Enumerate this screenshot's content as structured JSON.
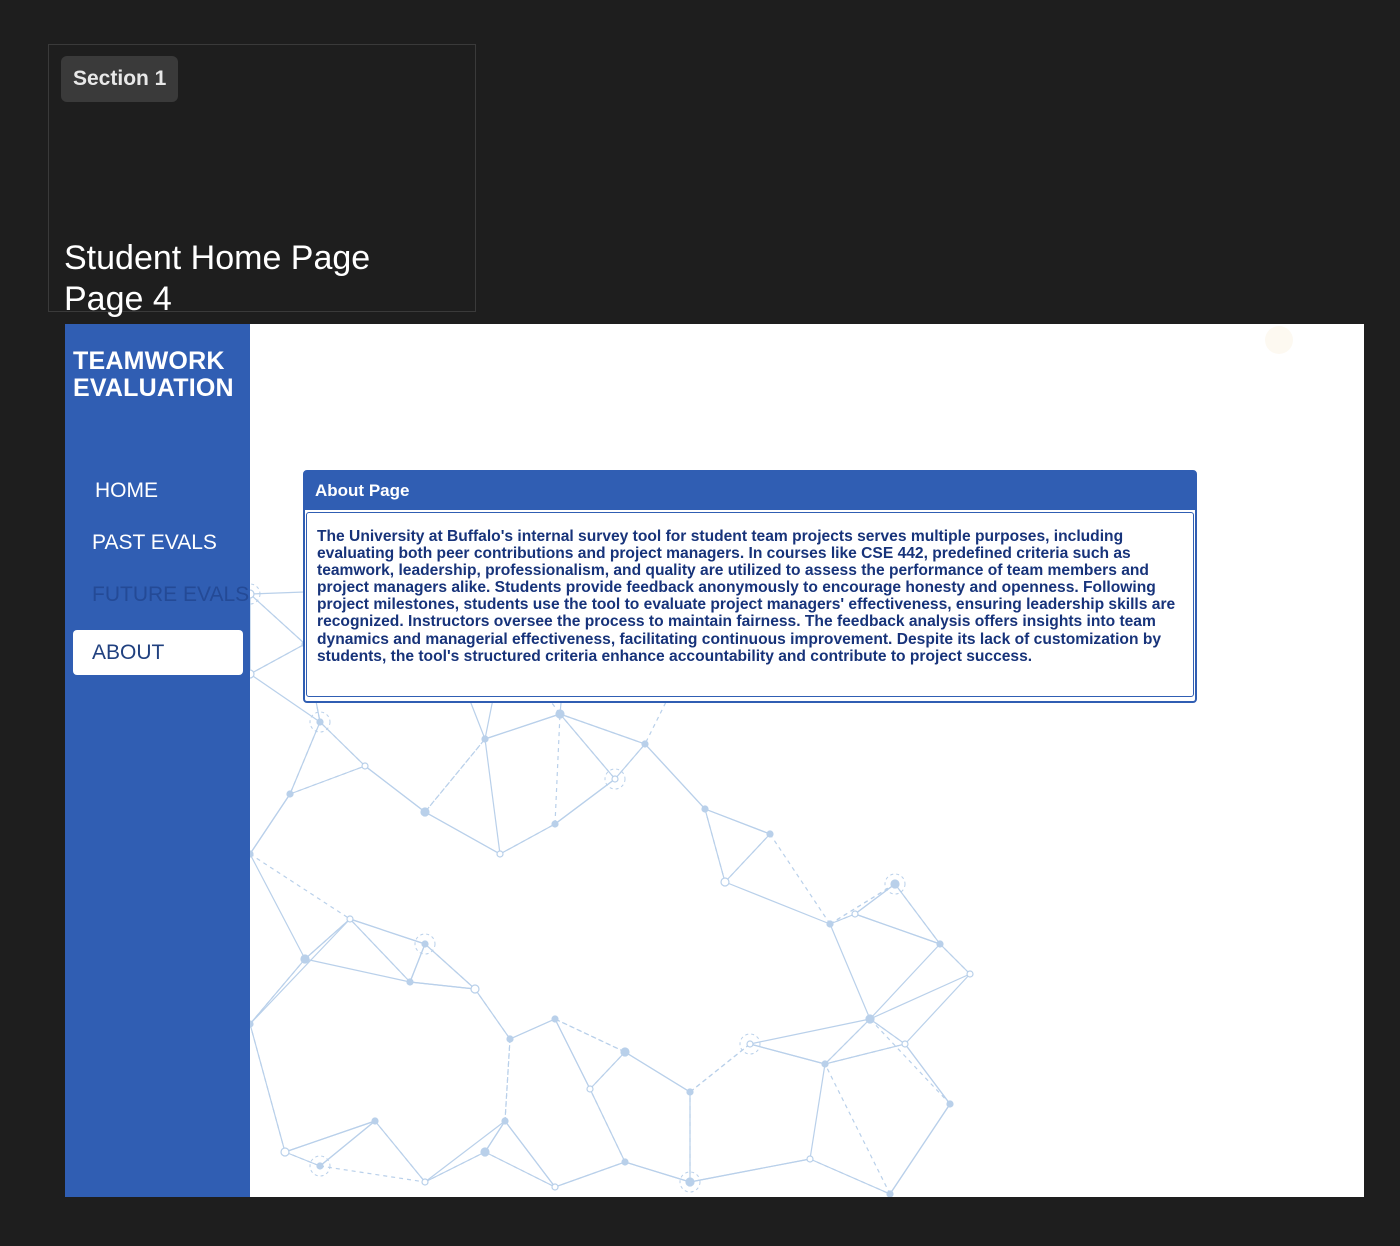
{
  "canvas": {
    "section_label": "Section 1",
    "frame_title": "Student Home Page",
    "frame_subtitle": "Page 4"
  },
  "app": {
    "logo": {
      "line1": "TEAMWORK",
      "line2": "EVALUATION"
    },
    "nav": {
      "home": "HOME",
      "past_evals": "PAST EVALS",
      "future_evals": "FUTURE EVALS",
      "about": "ABOUT",
      "active": "about"
    },
    "about": {
      "header": "About Page",
      "body": "The University at Buffalo's internal survey tool for student team projects serves multiple purposes, including evaluating both peer contributions and project managers. In courses like CSE 442, predefined criteria such as teamwork, leadership, professionalism, and quality are utilized to assess the performance of team members and project managers alike. Students provide feedback anonymously to encourage honesty and openness. Following project milestones, students use the tool to evaluate project managers' effectiveness, ensuring leadership skills are recognized. Instructors oversee the process to maintain fairness. The feedback analysis offers insights into team dynamics and managerial effectiveness, facilitating continuous improvement. Despite its lack of customization by students, the tool's structured criteria enhance accountability and contribute to project success."
    },
    "colors": {
      "sidebar": "#305eb3",
      "nav_future_text": "#244a96",
      "about_text": "#17337a",
      "network": "#b9d0ea",
      "canvas_bg": "#1e1e1e"
    },
    "background_pattern": "network-graph"
  }
}
